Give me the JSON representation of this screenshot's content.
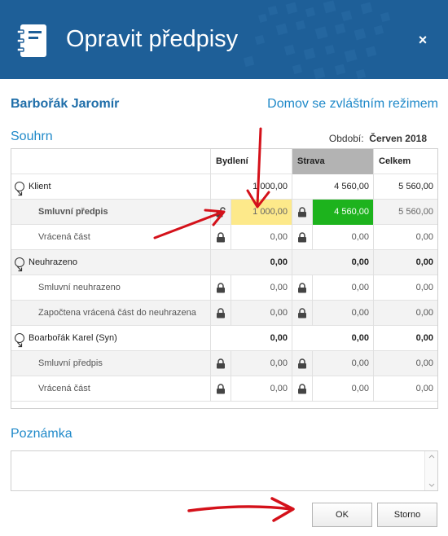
{
  "window": {
    "title": "Opravit předpisy",
    "close_label": "×"
  },
  "person": {
    "name": "Barbořák Jaromír",
    "mode": "Domov se zvláštním režimem"
  },
  "summary": {
    "title": "Souhrn",
    "period_label": "Období:",
    "period_value": "Červen 2018",
    "columns": {
      "bydleni": "Bydlení",
      "strava": "Strava",
      "celkem": "Celkem"
    },
    "rows": [
      {
        "label": "Klient",
        "bydleni": "1 000,00",
        "strava": "4 560,00",
        "celkem": "5 560,00"
      },
      {
        "label": "Smluvní předpis",
        "bydleni": "1 000,00",
        "strava": "4 560,00",
        "celkem": "5 560,00"
      },
      {
        "label": "Vrácená část",
        "bydleni": "0,00",
        "strava": "0,00",
        "celkem": "0,00"
      },
      {
        "label": "Neuhrazeno",
        "bydleni": "0,00",
        "strava": "0,00",
        "celkem": "0,00"
      },
      {
        "label": "Smluvní neuhrazeno",
        "bydleni": "0,00",
        "strava": "0,00",
        "celkem": "0,00"
      },
      {
        "label": "Započtena vrácená část do neuhrazena",
        "bydleni": "0,00",
        "strava": "0,00",
        "celkem": "0,00"
      },
      {
        "label": "Boarbořák Karel (Syn)",
        "bydleni": "0,00",
        "strava": "0,00",
        "celkem": "0,00"
      },
      {
        "label": "Smluvní předpis",
        "bydleni": "0,00",
        "strava": "0,00",
        "celkem": "0,00"
      },
      {
        "label": "Vrácená část",
        "bydleni": "0,00",
        "strava": "0,00",
        "celkem": "0,00"
      }
    ]
  },
  "note": {
    "title": "Poznámka",
    "value": ""
  },
  "buttons": {
    "ok": "OK",
    "cancel": "Storno"
  },
  "colors": {
    "titlebar": "#1e5f98",
    "accent": "#1f89c9",
    "highlight_yellow": "#fde98a",
    "highlight_green": "#1db31d",
    "strava_header": "#b3b3b3",
    "annotation_arrow": "#d4111a"
  }
}
